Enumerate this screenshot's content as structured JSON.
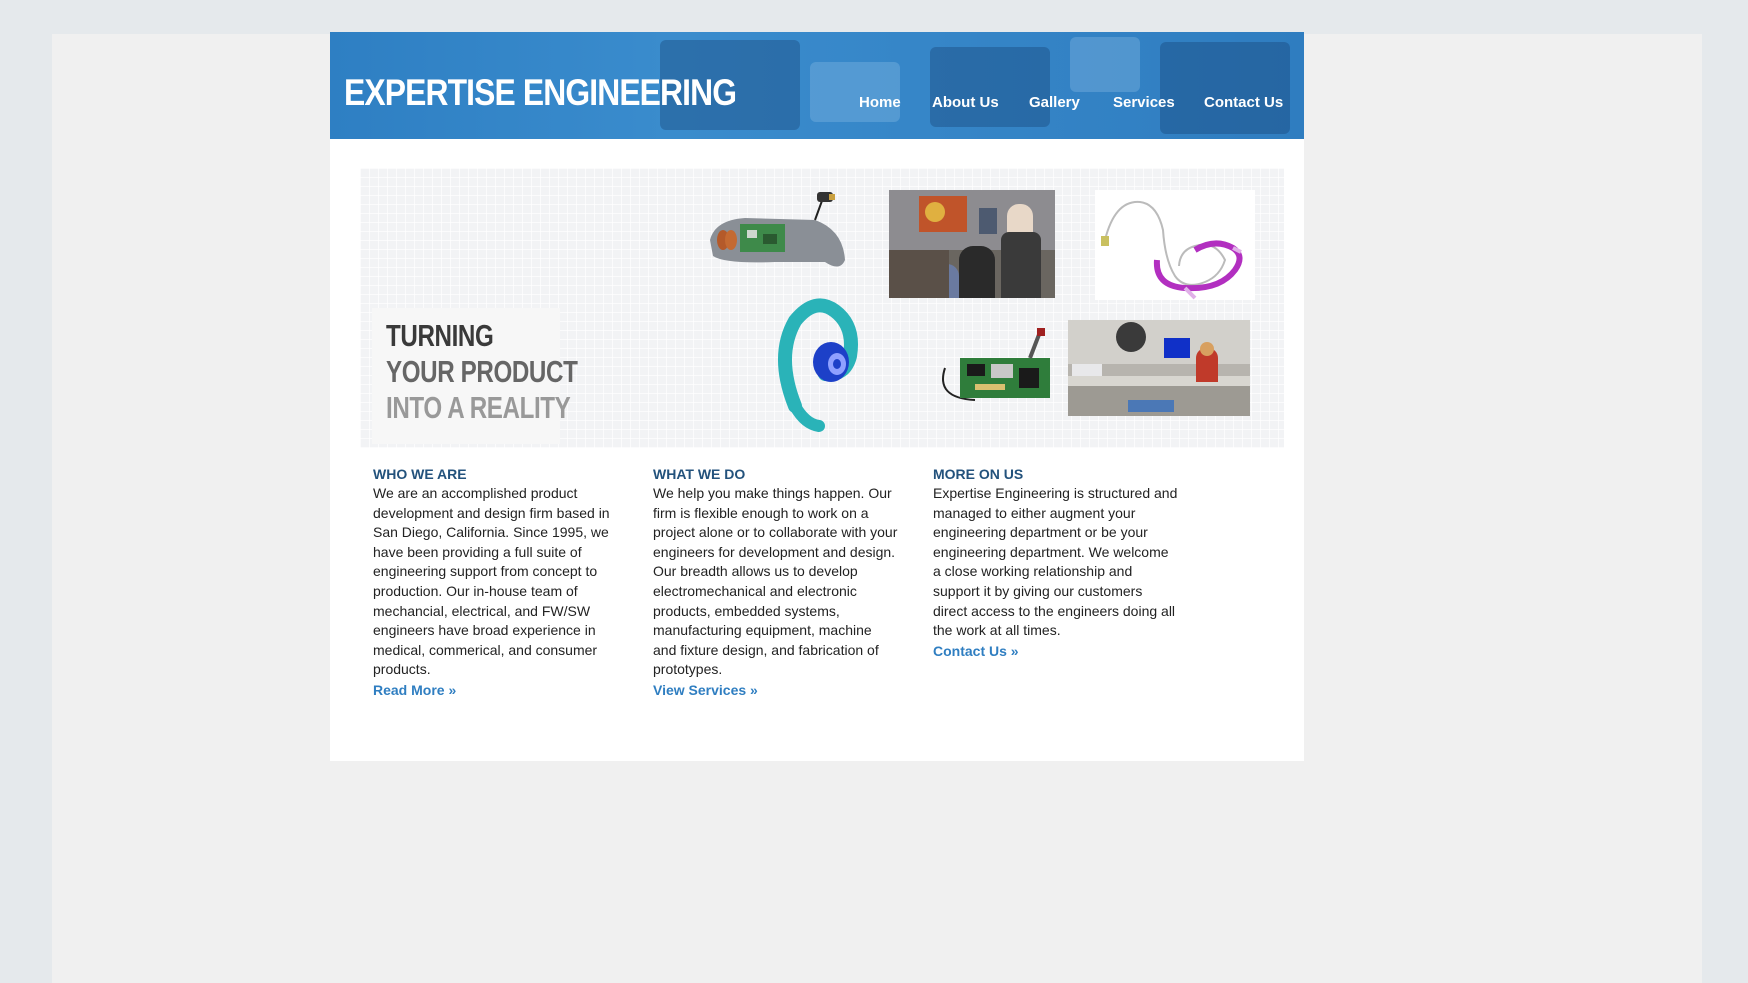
{
  "site": {
    "logo": "EXPERTISE ENGINEERING",
    "nav": [
      {
        "label": "Home"
      },
      {
        "label": "About Us"
      },
      {
        "label": "Gallery"
      },
      {
        "label": "Services"
      },
      {
        "label": "Contact Us"
      }
    ]
  },
  "hero": {
    "tagline": [
      "TURNING",
      "YOUR PRODUCT",
      "INTO A REALITY"
    ]
  },
  "columns": [
    {
      "heading": "WHO WE ARE",
      "lines": [
        "We are an accomplished product",
        "development and design firm based in",
        "San Diego, California. Since 1995, we",
        "have been providing a full suite of",
        "engineering support from concept to",
        "production. Our in-house team of",
        "mechancial, electrical, and FW/SW",
        "engineers have broad experience in",
        "medical, commerical, and consumer",
        "products."
      ],
      "link": "Read More »"
    },
    {
      "heading": "WHAT WE DO",
      "lines": [
        "We help you make things happen. Our",
        "firm is flexible enough to work on a",
        "project alone or to collaborate with your",
        "engineers for development and design.",
        "Our breadth allows us to develop",
        "electromechanical and electronic",
        "products, embedded systems,",
        "manufacturing equipment, machine",
        "and fixture design, and fabrication of",
        "prototypes."
      ],
      "link": "View Services »"
    },
    {
      "heading": "MORE ON US",
      "lines": [
        "Expertise Engineering is structured and",
        "managed to either augment your",
        "engineering department or be your",
        "engineering department. We welcome",
        "a close working relationship and",
        "support it by giving our customers",
        "direct access to the engineers doing all",
        "the work at all times."
      ],
      "link": "Contact Us »"
    }
  ],
  "colors": {
    "header_blue": "#3686c8",
    "heading_blue": "#23527c",
    "link_blue": "#2f7ec1",
    "body_text": "#222222"
  }
}
